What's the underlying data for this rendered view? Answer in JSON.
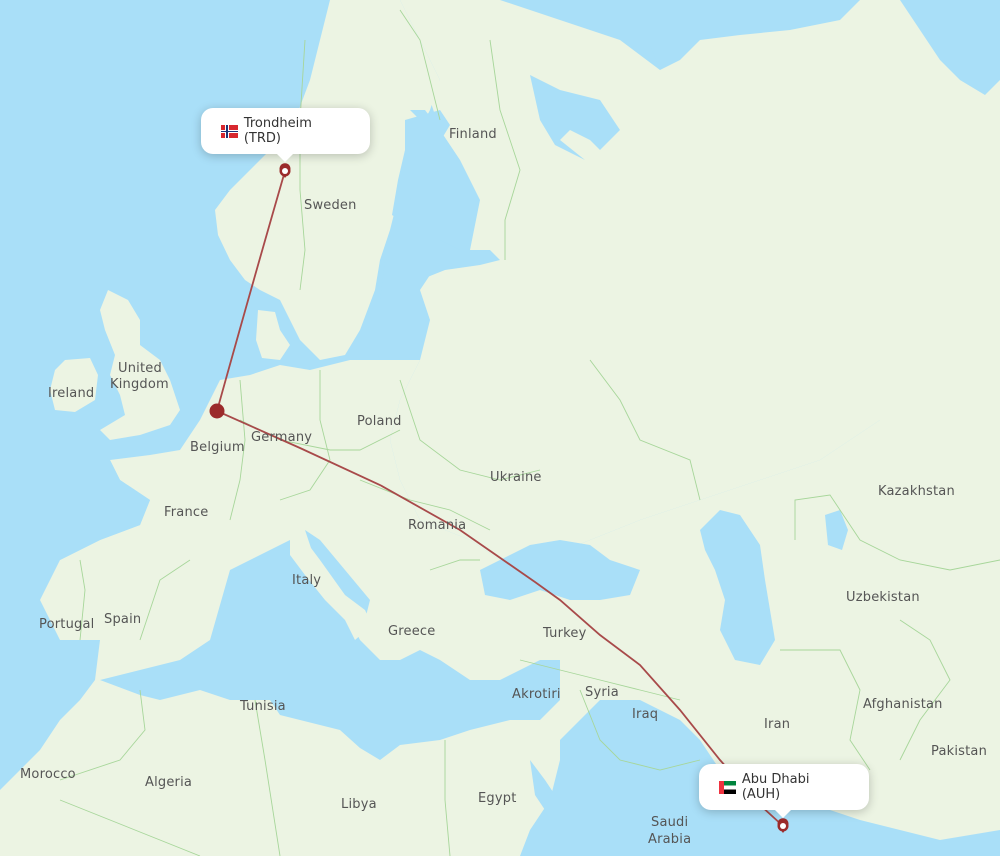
{
  "map": {
    "colors": {
      "water": "#a9dff8",
      "land": "#ecf4e3",
      "land_shade": "#e3efd7",
      "border": "#a7d69a",
      "route": "#a84a4a",
      "hub": "#9b2b2b",
      "label": "#555555"
    },
    "route": {
      "origin": {
        "city": "Trondheim",
        "code": "TRD",
        "label": "Trondheim (TRD)",
        "country": "Norway",
        "flag": "norway-flag"
      },
      "stopover": {
        "description": "connection point near Amsterdam/Belgium area"
      },
      "destination": {
        "city": "Abu Dhabi",
        "code": "AUH",
        "label": "Abu Dhabi (AUH)",
        "country": "United Arab Emirates",
        "flag": "uae-flag"
      }
    },
    "country_labels": [
      "Finland",
      "Sweden",
      "United",
      "Kingdom",
      "Ireland",
      "Poland",
      "Germany",
      "Belgium",
      "Ukraine",
      "Kazakhstan",
      "France",
      "Romania",
      "Uzbekistan",
      "Italy",
      "Spain",
      "Portugal",
      "Greece",
      "Turkey",
      "Akrotiri",
      "Syria",
      "Afghanistan",
      "Tunisia",
      "Iraq",
      "Iran",
      "Pakistan",
      "Morocco",
      "Algeria",
      "Libya",
      "Egypt",
      "Saudi",
      "Arabia"
    ]
  }
}
